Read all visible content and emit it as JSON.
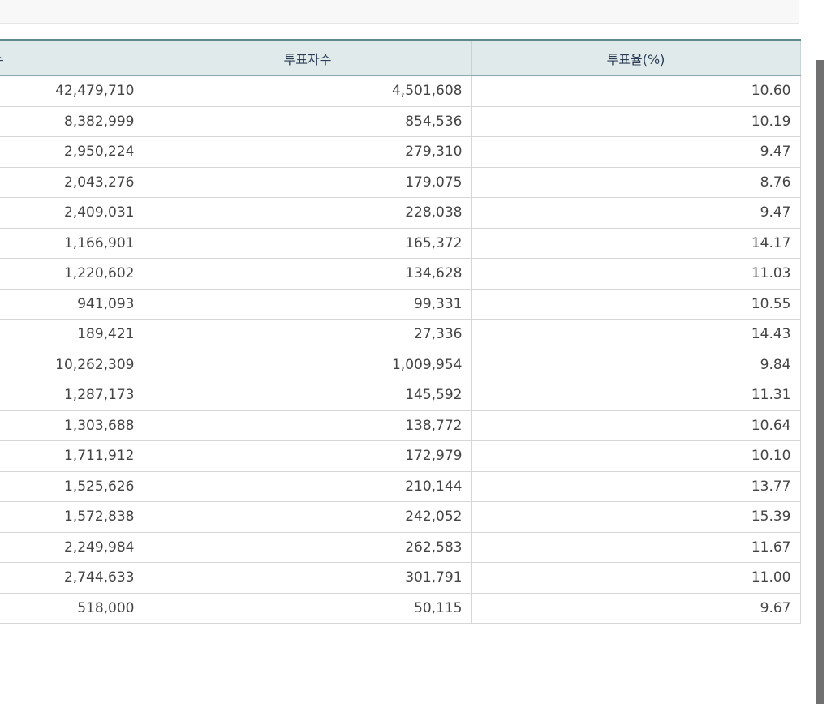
{
  "table": {
    "headers": [
      "수",
      "투표자수",
      "투표율(%)"
    ],
    "rows": [
      [
        "42,479,710",
        "4,501,608",
        "10.60"
      ],
      [
        "8,382,999",
        "854,536",
        "10.19"
      ],
      [
        "2,950,224",
        "279,310",
        "9.47"
      ],
      [
        "2,043,276",
        "179,075",
        "8.76"
      ],
      [
        "2,409,031",
        "228,038",
        "9.47"
      ],
      [
        "1,166,901",
        "165,372",
        "14.17"
      ],
      [
        "1,220,602",
        "134,628",
        "11.03"
      ],
      [
        "941,093",
        "99,331",
        "10.55"
      ],
      [
        "189,421",
        "27,336",
        "14.43"
      ],
      [
        "10,262,309",
        "1,009,954",
        "9.84"
      ],
      [
        "1,287,173",
        "145,592",
        "11.31"
      ],
      [
        "1,303,688",
        "138,772",
        "10.64"
      ],
      [
        "1,711,912",
        "172,979",
        "10.10"
      ],
      [
        "1,525,626",
        "210,144",
        "13.77"
      ],
      [
        "1,572,838",
        "242,052",
        "15.39"
      ],
      [
        "2,249,984",
        "262,583",
        "11.67"
      ],
      [
        "2,744,633",
        "301,791",
        "11.00"
      ],
      [
        "518,000",
        "50,115",
        "9.67"
      ]
    ]
  }
}
